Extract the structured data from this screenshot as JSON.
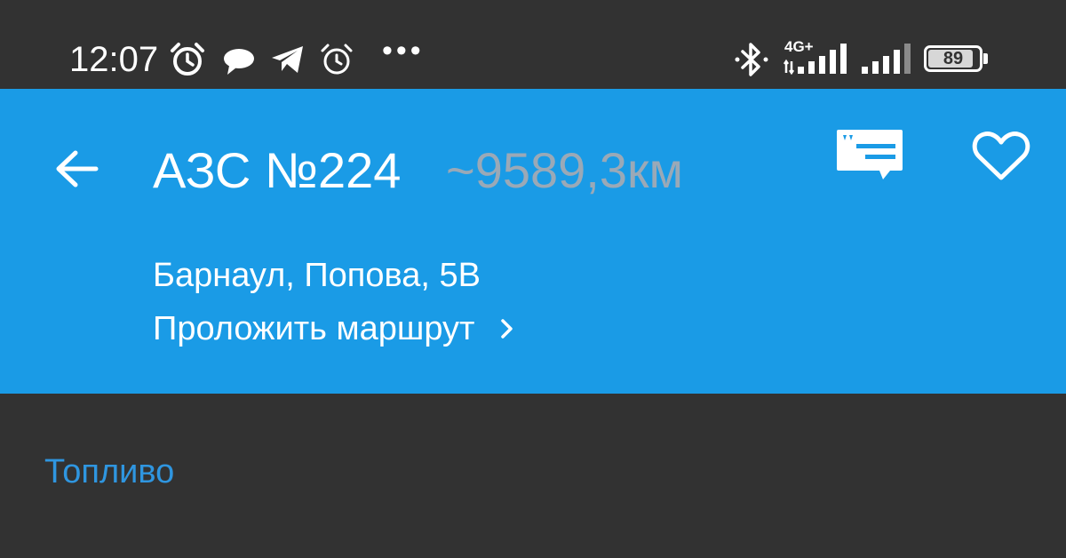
{
  "status_bar": {
    "time": "12:07",
    "icons": [
      "alarm-icon",
      "chat-bubble-icon",
      "telegram-icon",
      "alarm-clock-icon",
      "more-dots-icon",
      "bluetooth-icon",
      "signal-icon",
      "signal-icon-2",
      "battery-icon"
    ],
    "more": "•••",
    "network": "4G+",
    "battery_level": "89",
    "battery_fraction": 0.89
  },
  "header": {
    "title": "АЗС №224",
    "distance": "~9589,3км",
    "address": "Барнаул, Попова, 5В",
    "route_label": "Проложить маршрут",
    "background_color": "#1a9be6"
  },
  "section": {
    "title": "Топливо",
    "accent_color": "#2f96e0"
  }
}
